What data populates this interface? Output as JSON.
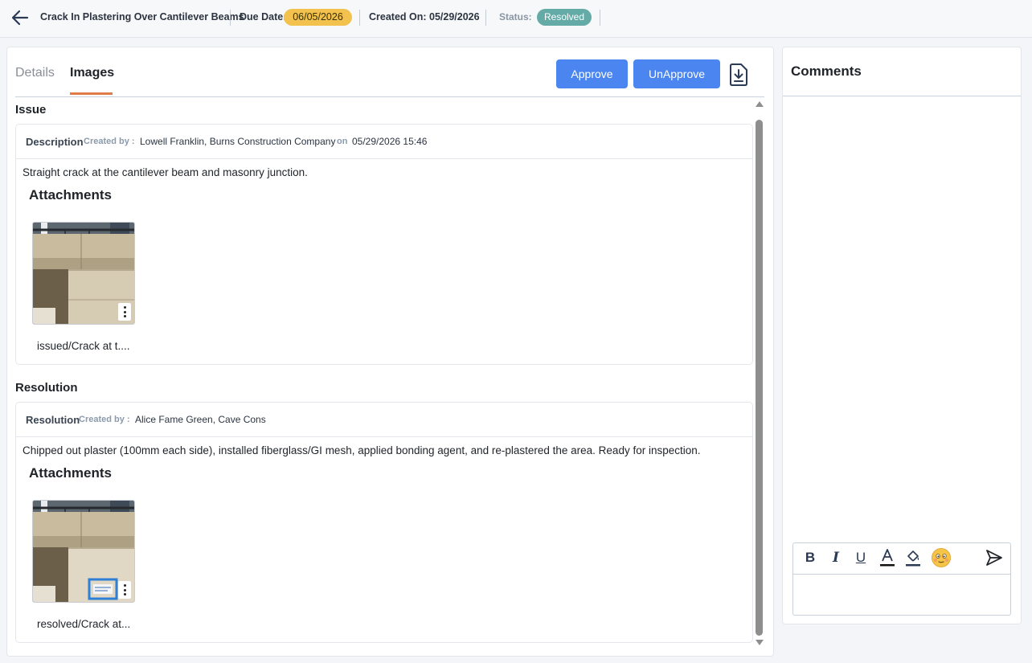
{
  "header": {
    "title": "Crack In Plastering Over Cantilever Beams",
    "due_label": "Due Date:",
    "due_value": "06/05/2026",
    "created_label": "Created On: 05/29/2026",
    "status_label": "Status:",
    "status_value": "Resolved"
  },
  "tabs": {
    "details": "Details",
    "images": "Images"
  },
  "actions": {
    "approve": "Approve",
    "unapprove": "UnApprove"
  },
  "issue": {
    "section_title": "Issue",
    "kind": "Description",
    "created_by_label": "Created by :",
    "creator": "Lowell Franklin, Burns Construction Company",
    "on_label": "on",
    "date": "05/29/2026 15:46",
    "text": "Straight crack at the cantilever beam and masonry junction.",
    "attachments_title": "Attachments",
    "attachment_name": "issued/Crack at t...."
  },
  "resolution": {
    "section_title": "Resolution",
    "kind": "Resolution",
    "created_by_label": "Created by :",
    "creator": "Alice Fame Green, Cave Cons",
    "text": "Chipped out plaster (100mm each side), installed fiberglass/GI mesh, applied bonding agent, and re-plastered the area. Ready for inspection.",
    "attachments_title": "Attachments",
    "attachment_name": "resolved/Crack at..."
  },
  "comments": {
    "title": "Comments",
    "toolbar": [
      "bold-icon",
      "italic-icon",
      "underline-icon",
      "font-color-icon",
      "highlight-color-icon",
      "emoji-icon",
      "send-icon"
    ]
  },
  "colors": {
    "accent": "#4a85f0",
    "tab_active": "#e07b4a",
    "due_chip": "#f2c14e",
    "status_chip": "#64aaa6"
  }
}
